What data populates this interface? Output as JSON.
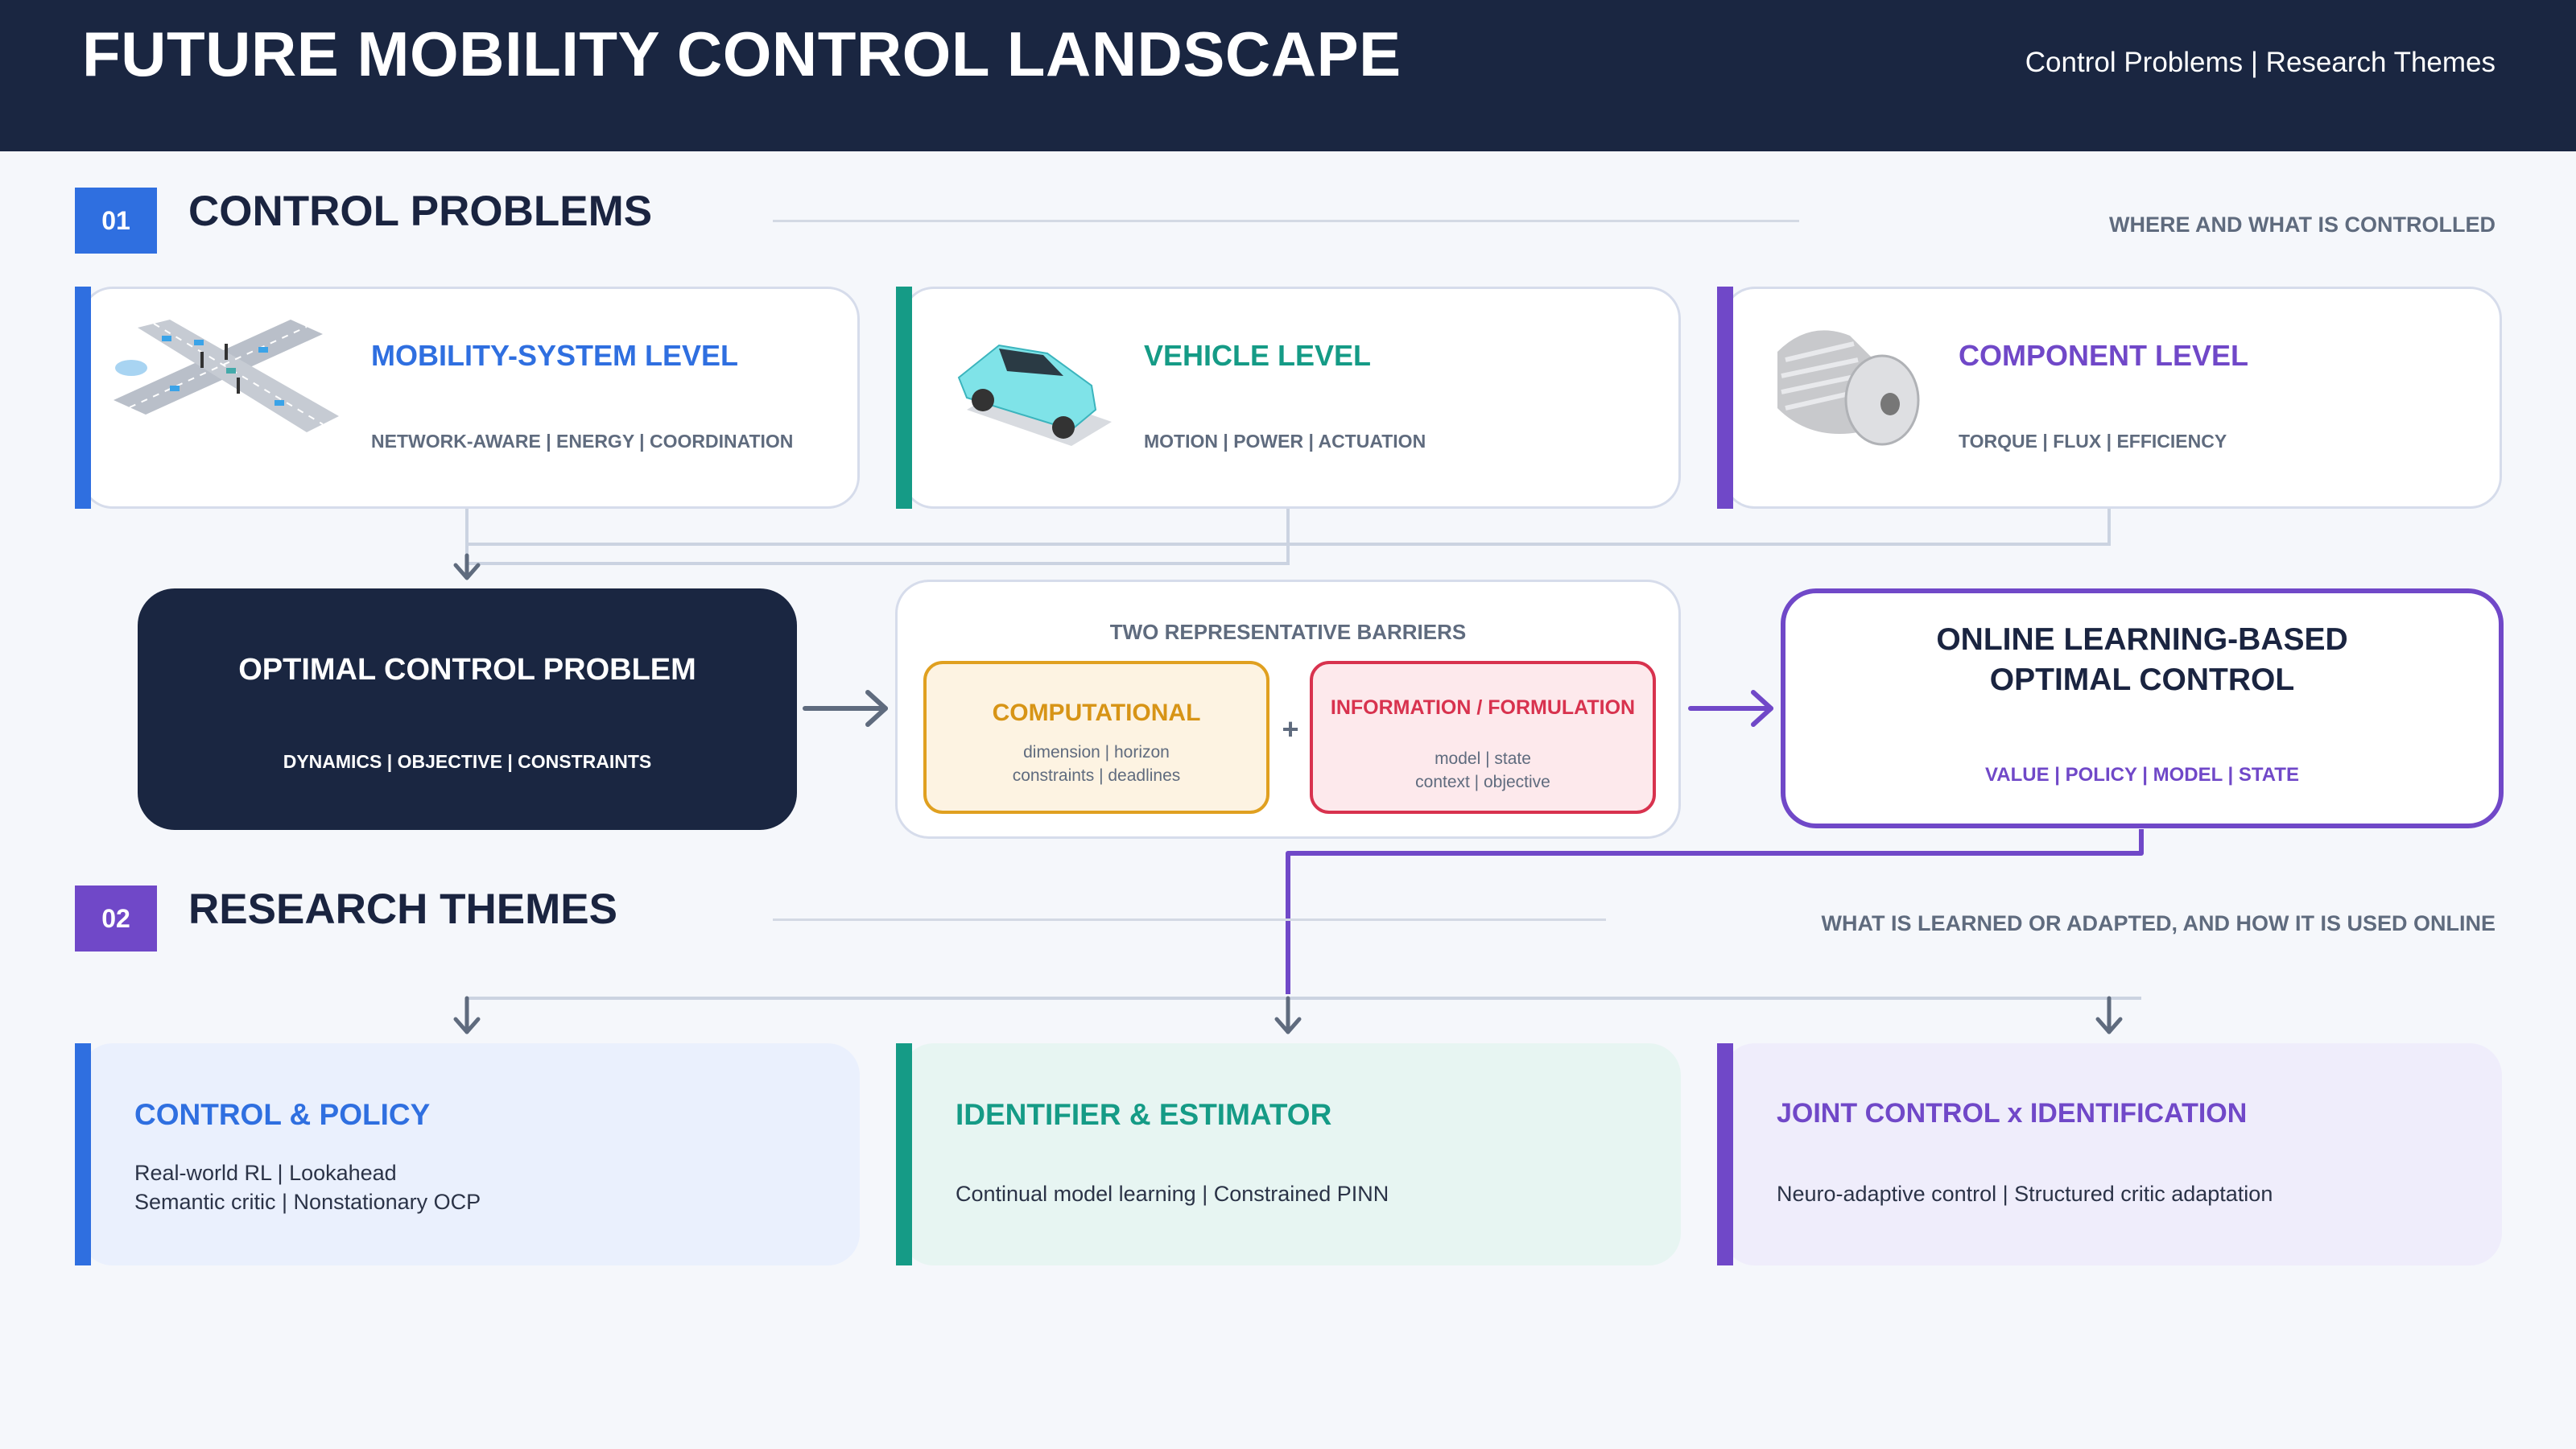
{
  "header": {
    "title": "FUTURE MOBILITY CONTROL LANDSCAPE",
    "nav": "Control Problems  |  Research Themes"
  },
  "section1": {
    "number": "01",
    "title": "CONTROL PROBLEMS",
    "subtitle": "WHERE AND WHAT IS CONTROLLED"
  },
  "levels": [
    {
      "title": "MOBILITY-SYSTEM LEVEL",
      "tags": "NETWORK-AWARE | ENERGY | COORDINATION",
      "color": "#2f6fe0",
      "icon": "intersection-icon"
    },
    {
      "title": "VEHICLE LEVEL",
      "tags": "MOTION  |  POWER  |  ACTUATION",
      "color": "#159b86",
      "icon": "car-icon"
    },
    {
      "title": "COMPONENT LEVEL",
      "tags": "TORQUE  |  FLUX  |  EFFICIENCY",
      "color": "#7048c8",
      "icon": "electric-motor-icon"
    }
  ],
  "ocp": {
    "title": "OPTIMAL CONTROL PROBLEM",
    "tags": "DYNAMICS  |  OBJECTIVE  |  CONSTRAINTS"
  },
  "barriers": {
    "heading": "TWO REPRESENTATIVE BARRIERS",
    "plus": "+",
    "computational": {
      "title": "COMPUTATIONAL",
      "line1": "dimension  |  horizon",
      "line2": "constraints  |  deadlines"
    },
    "information": {
      "title": "INFORMATION / FORMULATION",
      "line1": "model  |  state",
      "line2": "context  |  objective"
    }
  },
  "online": {
    "line1": "ONLINE LEARNING-BASED",
    "line2": "OPTIMAL CONTROL",
    "tags": "VALUE  |  POLICY  |  MODEL  |  STATE"
  },
  "section2": {
    "number": "02",
    "title": "RESEARCH THEMES",
    "subtitle": "WHAT IS LEARNED OR ADAPTED, AND HOW IT IS USED ONLINE"
  },
  "themes": [
    {
      "title": "CONTROL & POLICY",
      "line1": "Real-world RL  |  Lookahead",
      "line2": "Semantic critic  |  Nonstationary OCP",
      "color": "#2f6fe0",
      "bg": "#eaf0fd"
    },
    {
      "title": "IDENTIFIER & ESTIMATOR",
      "line1": "Continual model learning  |  Constrained PINN",
      "line2": "",
      "color": "#159b86",
      "bg": "#e7f5f2"
    },
    {
      "title": "JOINT CONTROL x IDENTIFICATION",
      "line1": "Neuro-adaptive control  |  Structured critic adaptation",
      "line2": "",
      "color": "#7048c8",
      "bg": "#efedfb"
    }
  ],
  "colors": {
    "navy": "#1a2641",
    "blue": "#2f6fe0",
    "teal": "#159b86",
    "purple": "#7048c8",
    "orange": "#e0a020",
    "red": "#d8324e"
  }
}
